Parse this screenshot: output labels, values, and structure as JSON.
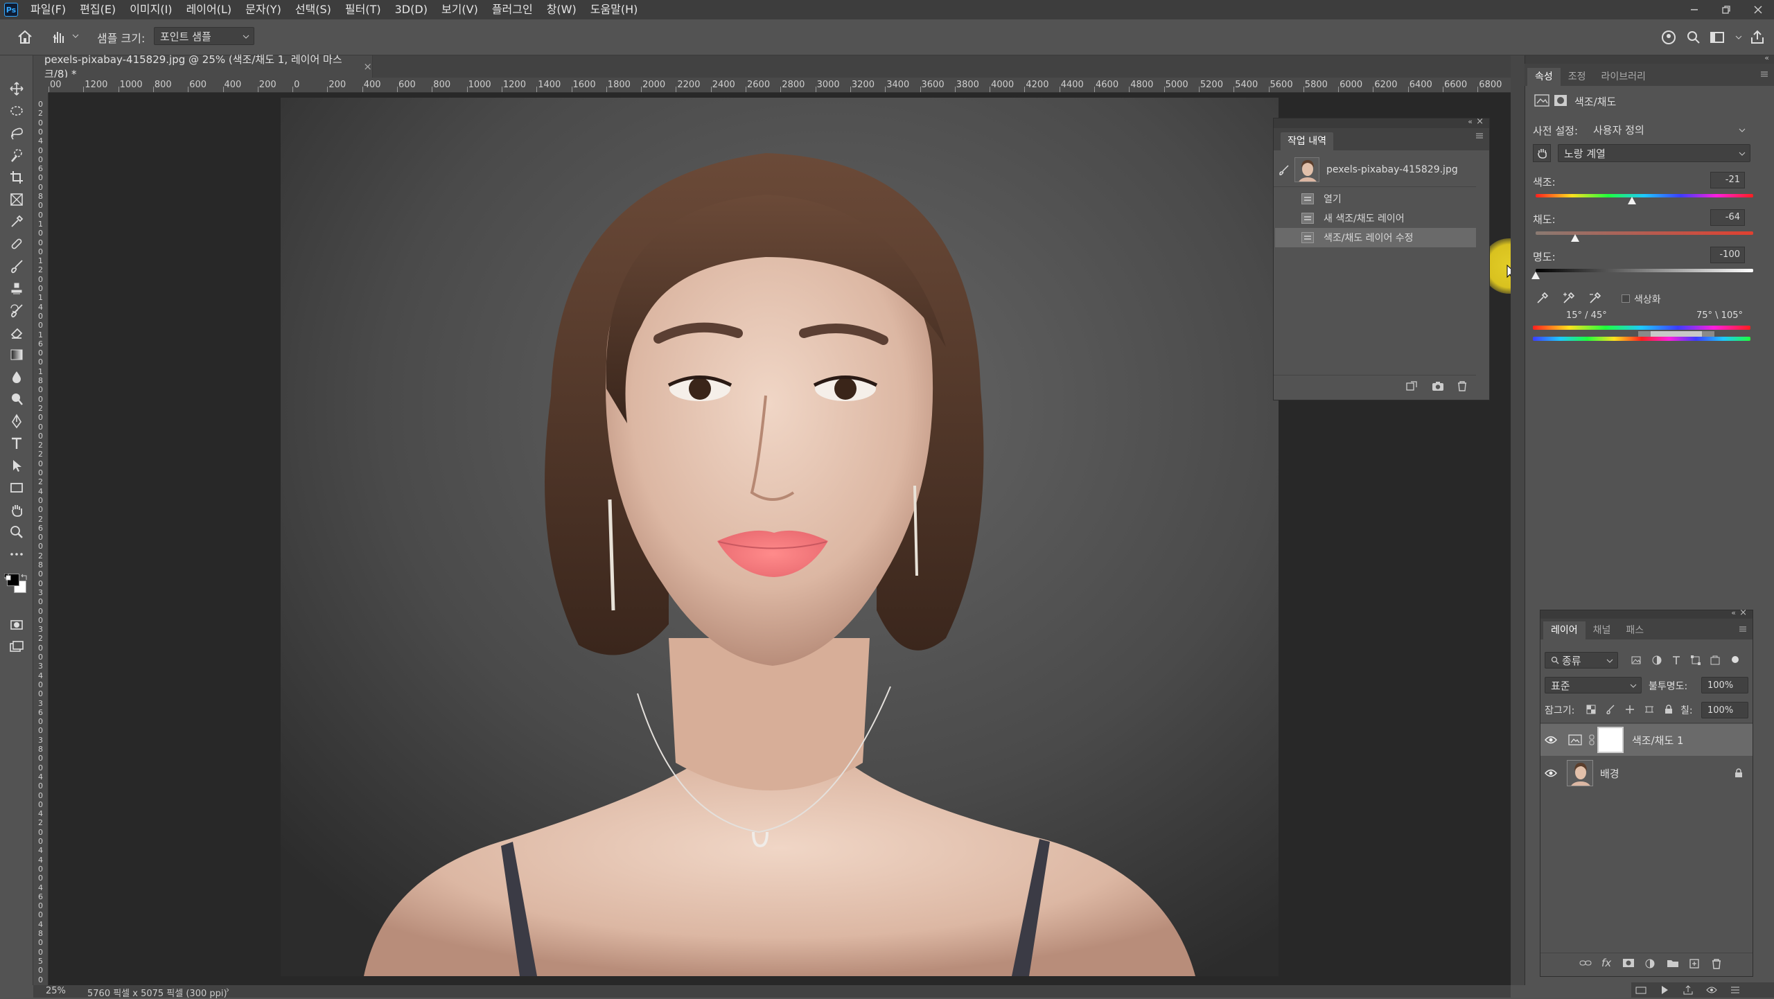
{
  "menubar": {
    "app_icon": "Ps",
    "items": [
      "파일(F)",
      "편집(E)",
      "이미지(I)",
      "레이어(L)",
      "문자(Y)",
      "선택(S)",
      "필터(T)",
      "3D(D)",
      "보기(V)",
      "플러그인",
      "창(W)",
      "도움말(H)"
    ]
  },
  "options": {
    "sample_size_label": "샘플 크기:",
    "sample_size_value": "포인트 샘플"
  },
  "document": {
    "tab_title": "pexels-pixabay-415829.jpg @ 25% (색조/채도 1, 레이어 마스크/8) *",
    "close_glyph": "×",
    "zoom": "25%",
    "doc_info": "5760 픽셀 x 5075 픽셀 (300 ppi)",
    "status_arrow": "›"
  },
  "ruler": {
    "h_ticks": [
      "00",
      "1200",
      "1000",
      "800",
      "600",
      "400",
      "200",
      "0",
      "200",
      "400",
      "600",
      "800",
      "1000",
      "1200",
      "1400",
      "1600",
      "1800",
      "2000",
      "2200",
      "2400",
      "2600",
      "2800",
      "3000",
      "3200",
      "3400",
      "3600",
      "3800",
      "4000",
      "4200",
      "4400",
      "4600",
      "4800",
      "5000",
      "5200",
      "5400",
      "5600",
      "5800",
      "6000",
      "6200",
      "6400",
      "6600",
      "6800",
      "700"
    ],
    "v_ticks": [
      "0",
      "2",
      "0",
      "0",
      "4",
      "0",
      "0",
      "6",
      "0",
      "0",
      "8",
      "0",
      "0",
      "1",
      "0",
      "0",
      "0",
      "1",
      "2",
      "0",
      "0",
      "1",
      "4",
      "0",
      "0",
      "1",
      "6",
      "0",
      "0",
      "1",
      "8",
      "0",
      "0",
      "2",
      "0",
      "0",
      "0",
      "2",
      "2",
      "0",
      "0",
      "2",
      "4",
      "0",
      "0",
      "2",
      "6",
      "0",
      "0",
      "2",
      "8",
      "0",
      "0",
      "3",
      "0",
      "0",
      "0",
      "3",
      "2",
      "0",
      "0",
      "3",
      "4",
      "0",
      "0",
      "3",
      "6",
      "0",
      "0",
      "3",
      "8",
      "0",
      "0",
      "4",
      "0",
      "0",
      "0",
      "4",
      "2",
      "0",
      "0",
      "4",
      "4",
      "0",
      "0",
      "4",
      "6",
      "0",
      "0",
      "4",
      "8",
      "0",
      "0",
      "5",
      "0",
      "0",
      "0"
    ]
  },
  "history": {
    "tab": "작업 내역",
    "snapshot": "pexels-pixabay-415829.jpg",
    "steps": [
      "열기",
      "새 색조/채도 레이어",
      "색조/채도 레이어 수정"
    ]
  },
  "properties": {
    "tabs": [
      "속성",
      "조정",
      "라이브러리"
    ],
    "title": "색조/채도",
    "preset_label": "사전 설정:",
    "preset_value": "사용자 정의",
    "channel_value": "노랑 계열",
    "hue_label": "색조:",
    "hue_value": "-21",
    "hue_level": -21,
    "sat_label": "채도:",
    "sat_value": "-64",
    "sat_level": -64,
    "light_label": "명도:",
    "light_value": "-100",
    "light_level": -100,
    "colorize_label": "색상화",
    "range_left": "15° / 45°",
    "range_right": "75° \\ 105°"
  },
  "layers": {
    "tabs": [
      "레이어",
      "채널",
      "패스"
    ],
    "filter_label": "종류",
    "blend_mode": "표준",
    "opacity_label": "불투명도:",
    "opacity_value": "100%",
    "lock_label": "잠그기:",
    "fill_label": "칠:",
    "fill_value": "100%",
    "items": [
      {
        "name": "색조/채도 1",
        "selected": true
      },
      {
        "name": "배경",
        "locked": true
      }
    ],
    "footer_fx": "fx"
  },
  "colors": {
    "accent": "#31a8ff",
    "cursor_highlight": "#ecd628",
    "panel_bg": "#535353",
    "dark_bg": "#282828"
  }
}
